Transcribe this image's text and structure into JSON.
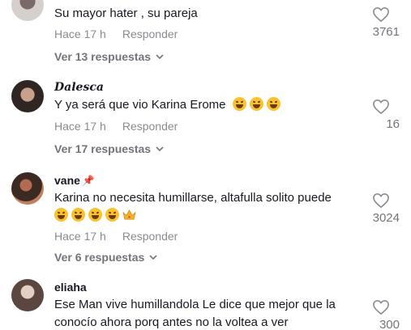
{
  "comments": [
    {
      "username": "",
      "text": "Su mayor hater , su pareja",
      "time": "Hace 17 h",
      "reply_label": "Responder",
      "likes": "3761",
      "view_replies": "Ver 13 respuestas"
    },
    {
      "username": "Dalesca",
      "text": "Y ya será que vio Karina Erome",
      "emoji": [
        "rofl-emoji",
        "rofl-emoji",
        "rofl-emoji"
      ],
      "time": "Hace 17 h",
      "reply_label": "Responder",
      "likes": "16",
      "view_replies": "Ver 17 respuestas"
    },
    {
      "username": "vane",
      "badge": "pin-icon",
      "text": "Karina no necesita humillarse, altafulla solito puede",
      "emoji": [
        "rofl-emoji",
        "rofl-emoji",
        "rofl-emoji",
        "rofl-emoji",
        "crown-emoji"
      ],
      "time": "Hace 17 h",
      "reply_label": "Responder",
      "likes": "3024",
      "view_replies": "Ver 6 respuestas"
    },
    {
      "username": "eliaha",
      "text": "Ese Man vive humillandola Le dice que mejor que la conocío ahora porq antes no la voltea a ver",
      "likes": "300"
    }
  ],
  "colors": {
    "text": "#161823",
    "secondary": "#8a8b91",
    "muted": "#73747b",
    "pin": "#fe2c55"
  }
}
